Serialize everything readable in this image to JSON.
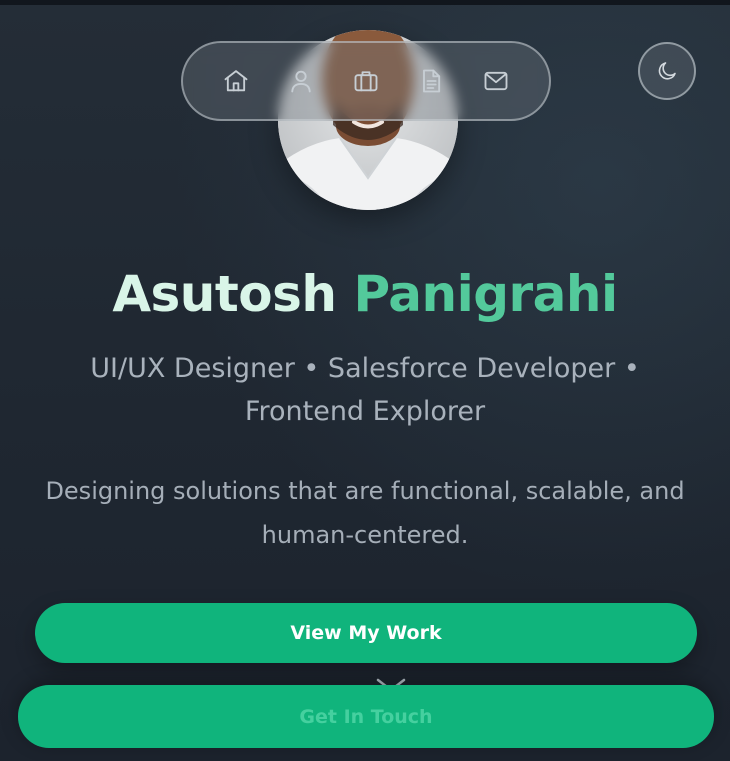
{
  "hero": {
    "name_first": "Asutosh",
    "name_last": "Panigrahi",
    "roles": "UI/UX Designer • Salesforce Developer • Frontend Explorer",
    "tagline": "Designing solutions that are functional, scalable, and human-centered.",
    "primary_button": "View My Work",
    "secondary_button": "Get In Touch"
  },
  "nav": {
    "items": [
      {
        "icon": "home-icon"
      },
      {
        "icon": "user-icon"
      },
      {
        "icon": "briefcase-icon"
      },
      {
        "icon": "document-icon"
      },
      {
        "icon": "mail-icon"
      }
    ]
  },
  "theme_toggle": {
    "icon": "moon-icon"
  },
  "colors": {
    "background": "#1f2731",
    "accent": "#10b47c",
    "name_first": "#d9f5e8",
    "name_last": "#53c99b",
    "muted_text": "#a9b2bc"
  }
}
